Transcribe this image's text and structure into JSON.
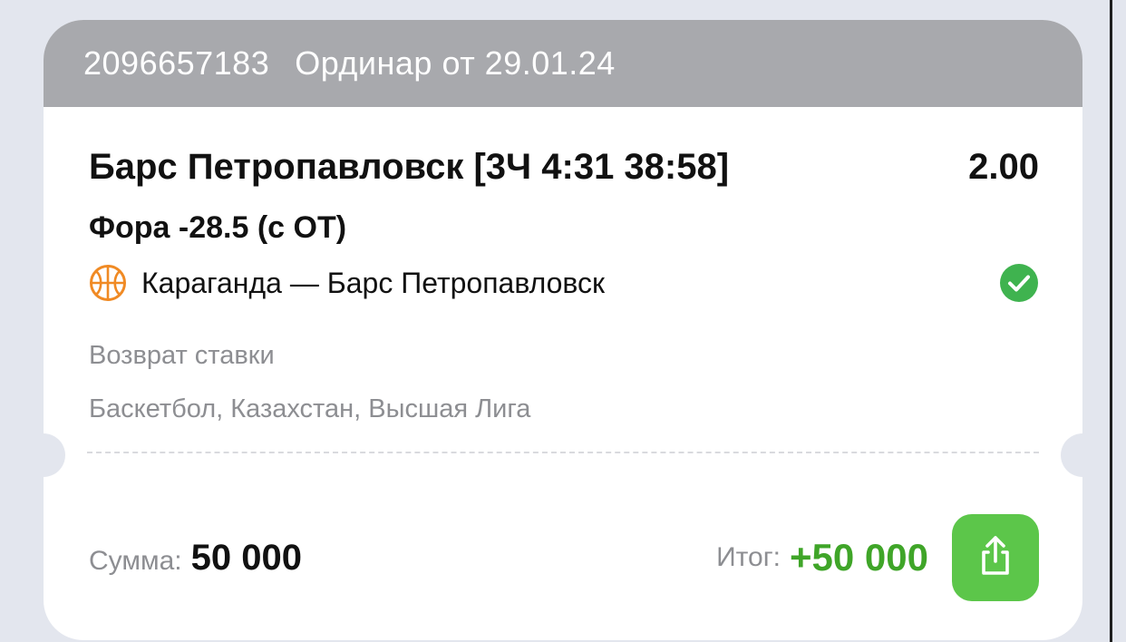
{
  "bet": {
    "id": "2096657183",
    "header_text": "Ординар от 29.01.24",
    "selection": "Барс Петропавловск [3Ч 4:31 38:58]",
    "odds": "2.00",
    "market": "Фора -28.5 (с ОТ)",
    "match": "Караганда — Барс Петропавловск",
    "sport_icon": "basketball-icon",
    "status_icon": "check-circle-icon",
    "result_text": "Возврат ставки",
    "league": "Баскетбол, Казахстан, Высшая Лига",
    "sum_label": "Сумма:",
    "sum_value": "50 000",
    "total_label": "Итог:",
    "total_value": "+50 000",
    "share_icon": "share-icon"
  },
  "colors": {
    "header_bg": "#a8a9ad",
    "accent_green": "#5cc64a",
    "total_green": "#3fa528",
    "ball_orange": "#f08a24",
    "muted_text": "#8d8e92"
  }
}
